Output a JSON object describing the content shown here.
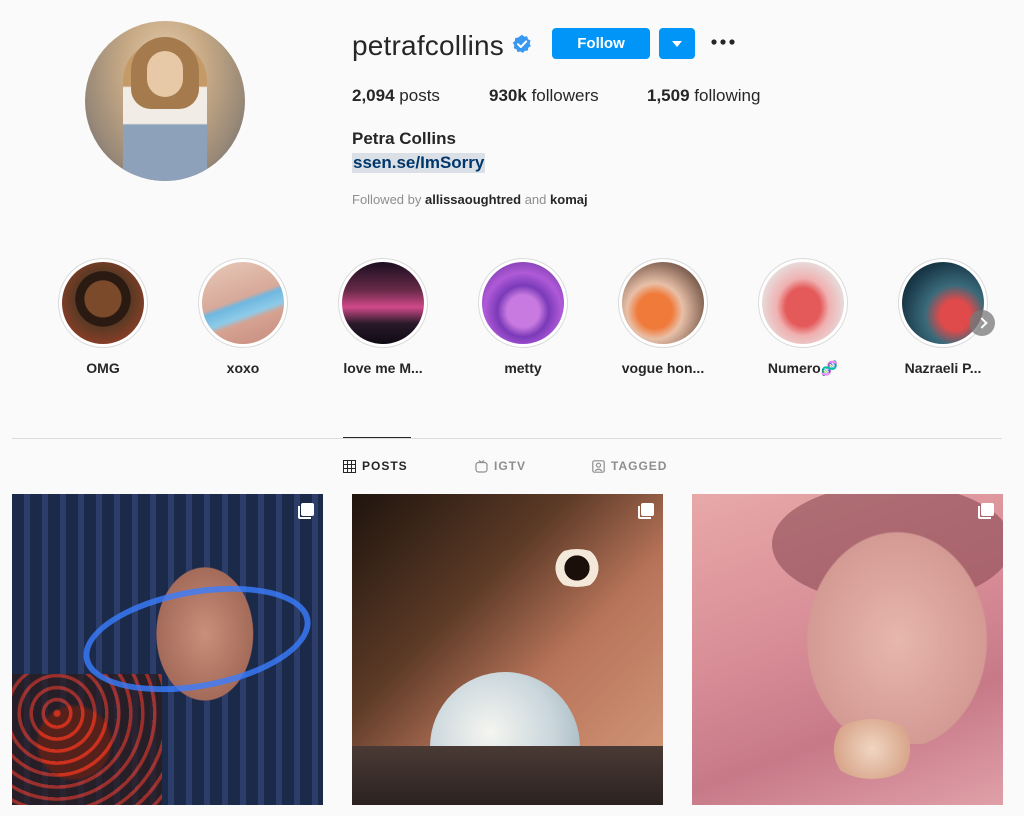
{
  "profile": {
    "username": "petrafcollins",
    "verified": true,
    "follow_label": "Follow",
    "stats": {
      "posts_count": "2,094",
      "posts_label": "posts",
      "followers_count": "930k",
      "followers_label": "followers",
      "following_count": "1,509",
      "following_label": "following"
    },
    "full_name": "Petra Collins",
    "bio_link": "ssen.se/ImSorry",
    "followed_by": {
      "prefix": "Followed by",
      "user1": "allissaoughtred",
      "conjunction": "and",
      "user2": "komaj"
    }
  },
  "highlights": [
    {
      "label": "OMG"
    },
    {
      "label": "xoxo"
    },
    {
      "label": "love me M..."
    },
    {
      "label": "metty"
    },
    {
      "label": "vogue hon..."
    },
    {
      "label": "Numero🧬"
    },
    {
      "label": "Nazraeli P..."
    }
  ],
  "tabs": [
    {
      "label": "POSTS",
      "icon": "grid-icon",
      "active": true
    },
    {
      "label": "IGTV",
      "icon": "igtv-icon",
      "active": false
    },
    {
      "label": "TAGGED",
      "icon": "tagged-icon",
      "active": false
    }
  ],
  "colors": {
    "accent": "#0095f6",
    "verified": "#3897f0",
    "link": "#00376b"
  }
}
